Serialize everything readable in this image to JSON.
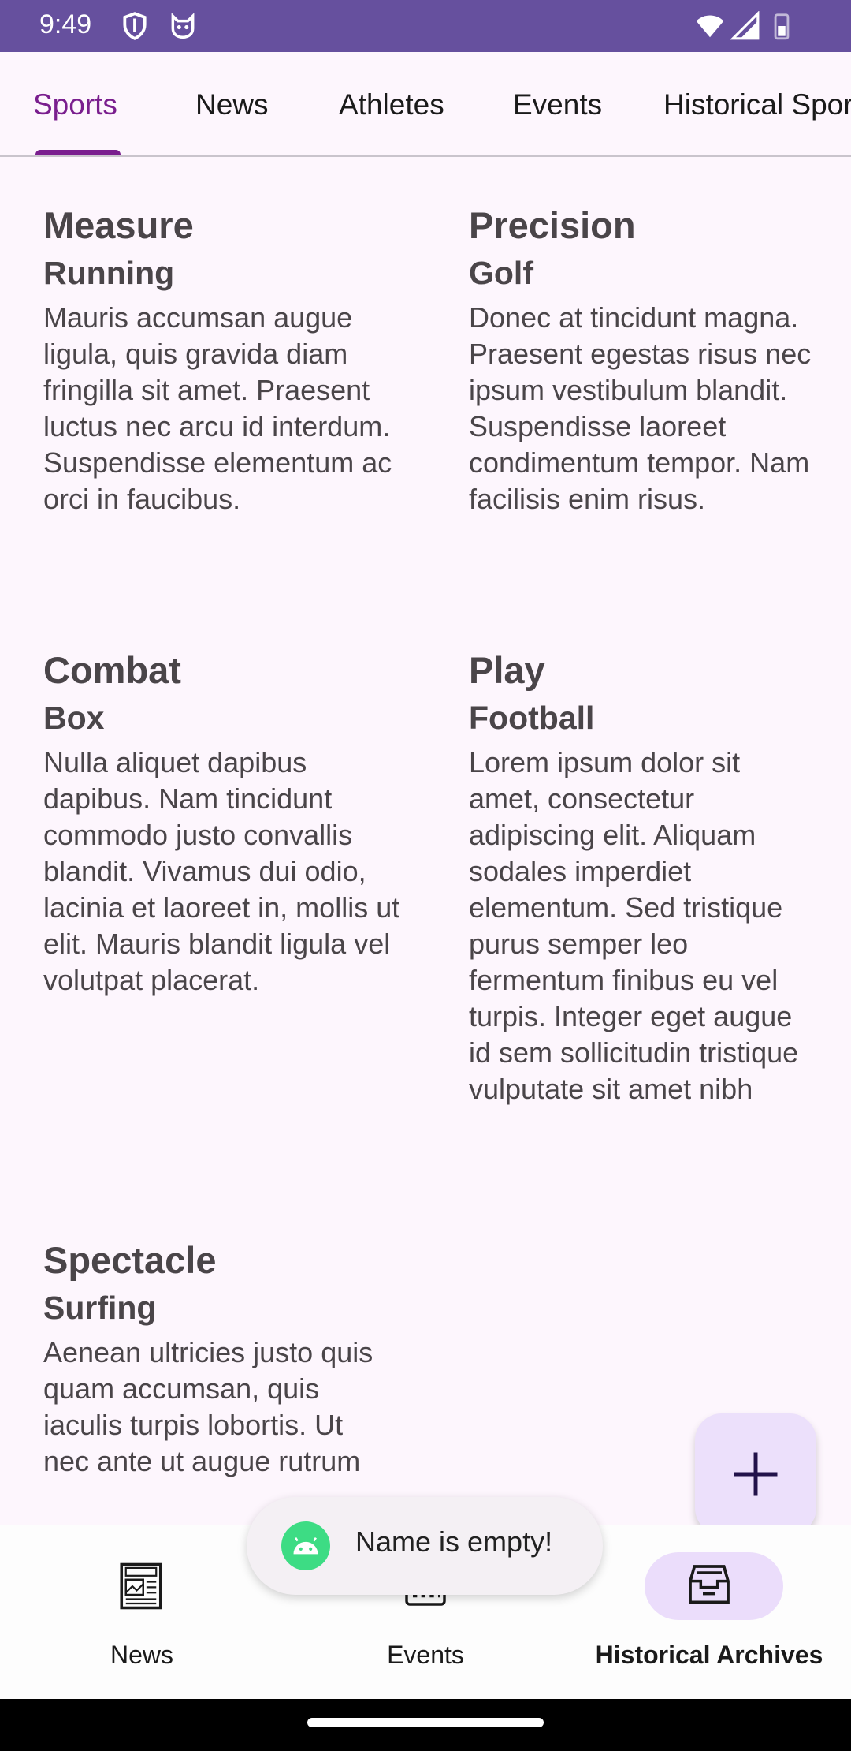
{
  "status_bar": {
    "time": "9:49",
    "icons_left": [
      "shield-icon",
      "cat-icon"
    ],
    "icons_right": [
      "wifi-icon",
      "signal-icon",
      "battery-icon"
    ],
    "color": "#66509e"
  },
  "tabs": [
    {
      "label": "Sports",
      "active": true
    },
    {
      "label": "News",
      "active": false
    },
    {
      "label": "Athletes",
      "active": false
    },
    {
      "label": "Events",
      "active": false
    },
    {
      "label": "Historical Sports",
      "active": false
    }
  ],
  "accent_color": "#7a1e8e",
  "cards": [
    {
      "category": "Measure",
      "sport": "Running",
      "description": "Mauris accumsan augue ligula, quis gravida diam fringilla sit amet. Praesent luctus nec arcu id interdum. Suspendisse elementum ac orci in faucibus."
    },
    {
      "category": "Precision",
      "sport": "Golf",
      "description": "Donec at tincidunt magna. Praesent egestas risus nec ipsum vestibulum blandit. Suspendisse laoreet condimentum tempor. Nam facilisis enim risus."
    },
    {
      "category": "Combat",
      "sport": "Box",
      "description": "Nulla aliquet dapibus dapibus. Nam tincidunt commodo justo convallis blandit. Vivamus dui odio, lacinia et laoreet in, mollis ut elit. Mauris blandit ligula vel volutpat placerat."
    },
    {
      "category": "Play",
      "sport": "Football",
      "description": "Lorem ipsum dolor sit amet, consectetur adipiscing elit. Aliquam sodales imperdiet elementum. Sed tristique purus semper leo fermentum finibus eu vel turpis. Integer eget augue id sem sollicitudin tristique vulputate sit amet nibh"
    },
    {
      "category": "Spectacle",
      "sport": "Surfing",
      "description": "Aenean ultricies justo quis quam accumsan, quis iaculis turpis lobortis. Ut nec ante ut augue rutrum"
    }
  ],
  "fab": {
    "icon": "add-icon"
  },
  "bottom_nav": [
    {
      "label": "News",
      "icon": "newspaper-icon",
      "active": false
    },
    {
      "label": "Events",
      "icon": "calendar-icon",
      "active": false
    },
    {
      "label": "Historical Archives",
      "icon": "archive-icon",
      "active": true
    }
  ],
  "toast": {
    "icon": "android-icon",
    "message": "Name is empty!"
  }
}
